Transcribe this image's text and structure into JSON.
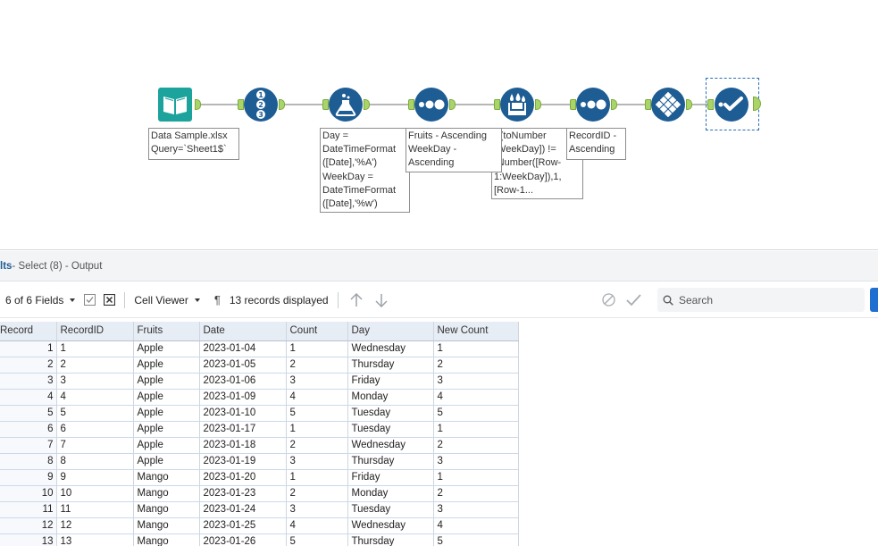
{
  "canvas": {
    "annotations": {
      "input": "Data Sample.xlsx\nQuery=`Sheet1$`",
      "formula": "Day =\nDateTimeFormat\n([Date],'%A')\nWeekDay =\nDateTimeFormat\n([Date],'%w')",
      "sort1": "Fruits - Ascending\nWeekDay -\nAscending",
      "multirow": "F(toNumber\n[WeekDay]) !=\n-Number([Row-\n1:WeekDay]),1,\n[Row-1...",
      "sort2": "RecordID -\nAscending"
    }
  },
  "results": {
    "title_prefix": "lts",
    "title_suffix": " - Select (8) - Output",
    "fields_label": "6 of 6 Fields",
    "viewer_label": "Cell Viewer",
    "records_label": "13 records displayed",
    "search_placeholder": "Search"
  },
  "table": {
    "columns": [
      "Record",
      "RecordID",
      "Fruits",
      "Date",
      "Count",
      "Day",
      "New Count"
    ],
    "rows": [
      [
        "1",
        "1",
        "Apple",
        "2023-01-04",
        "1",
        "Wednesday",
        "1"
      ],
      [
        "2",
        "2",
        "Apple",
        "2023-01-05",
        "2",
        "Thursday",
        "2"
      ],
      [
        "3",
        "3",
        "Apple",
        "2023-01-06",
        "3",
        "Friday",
        "3"
      ],
      [
        "4",
        "4",
        "Apple",
        "2023-01-09",
        "4",
        "Monday",
        "4"
      ],
      [
        "5",
        "5",
        "Apple",
        "2023-01-10",
        "5",
        "Tuesday",
        "5"
      ],
      [
        "6",
        "6",
        "Apple",
        "2023-01-17",
        "1",
        "Tuesday",
        "1"
      ],
      [
        "7",
        "7",
        "Apple",
        "2023-01-18",
        "2",
        "Wednesday",
        "2"
      ],
      [
        "8",
        "8",
        "Apple",
        "2023-01-19",
        "3",
        "Thursday",
        "3"
      ],
      [
        "9",
        "9",
        "Mango",
        "2023-01-20",
        "1",
        "Friday",
        "1"
      ],
      [
        "10",
        "10",
        "Mango",
        "2023-01-23",
        "2",
        "Monday",
        "2"
      ],
      [
        "11",
        "11",
        "Mango",
        "2023-01-24",
        "3",
        "Tuesday",
        "3"
      ],
      [
        "12",
        "12",
        "Mango",
        "2023-01-25",
        "4",
        "Wednesday",
        "4"
      ],
      [
        "13",
        "13",
        "Mango",
        "2023-01-26",
        "5",
        "Thursday",
        "5"
      ]
    ]
  },
  "colors": {
    "tool_blue": "#1e5c94",
    "input_teal": "#1ba39c",
    "anchor_green": "#a9d46a",
    "accent": "#1e6fd1"
  }
}
